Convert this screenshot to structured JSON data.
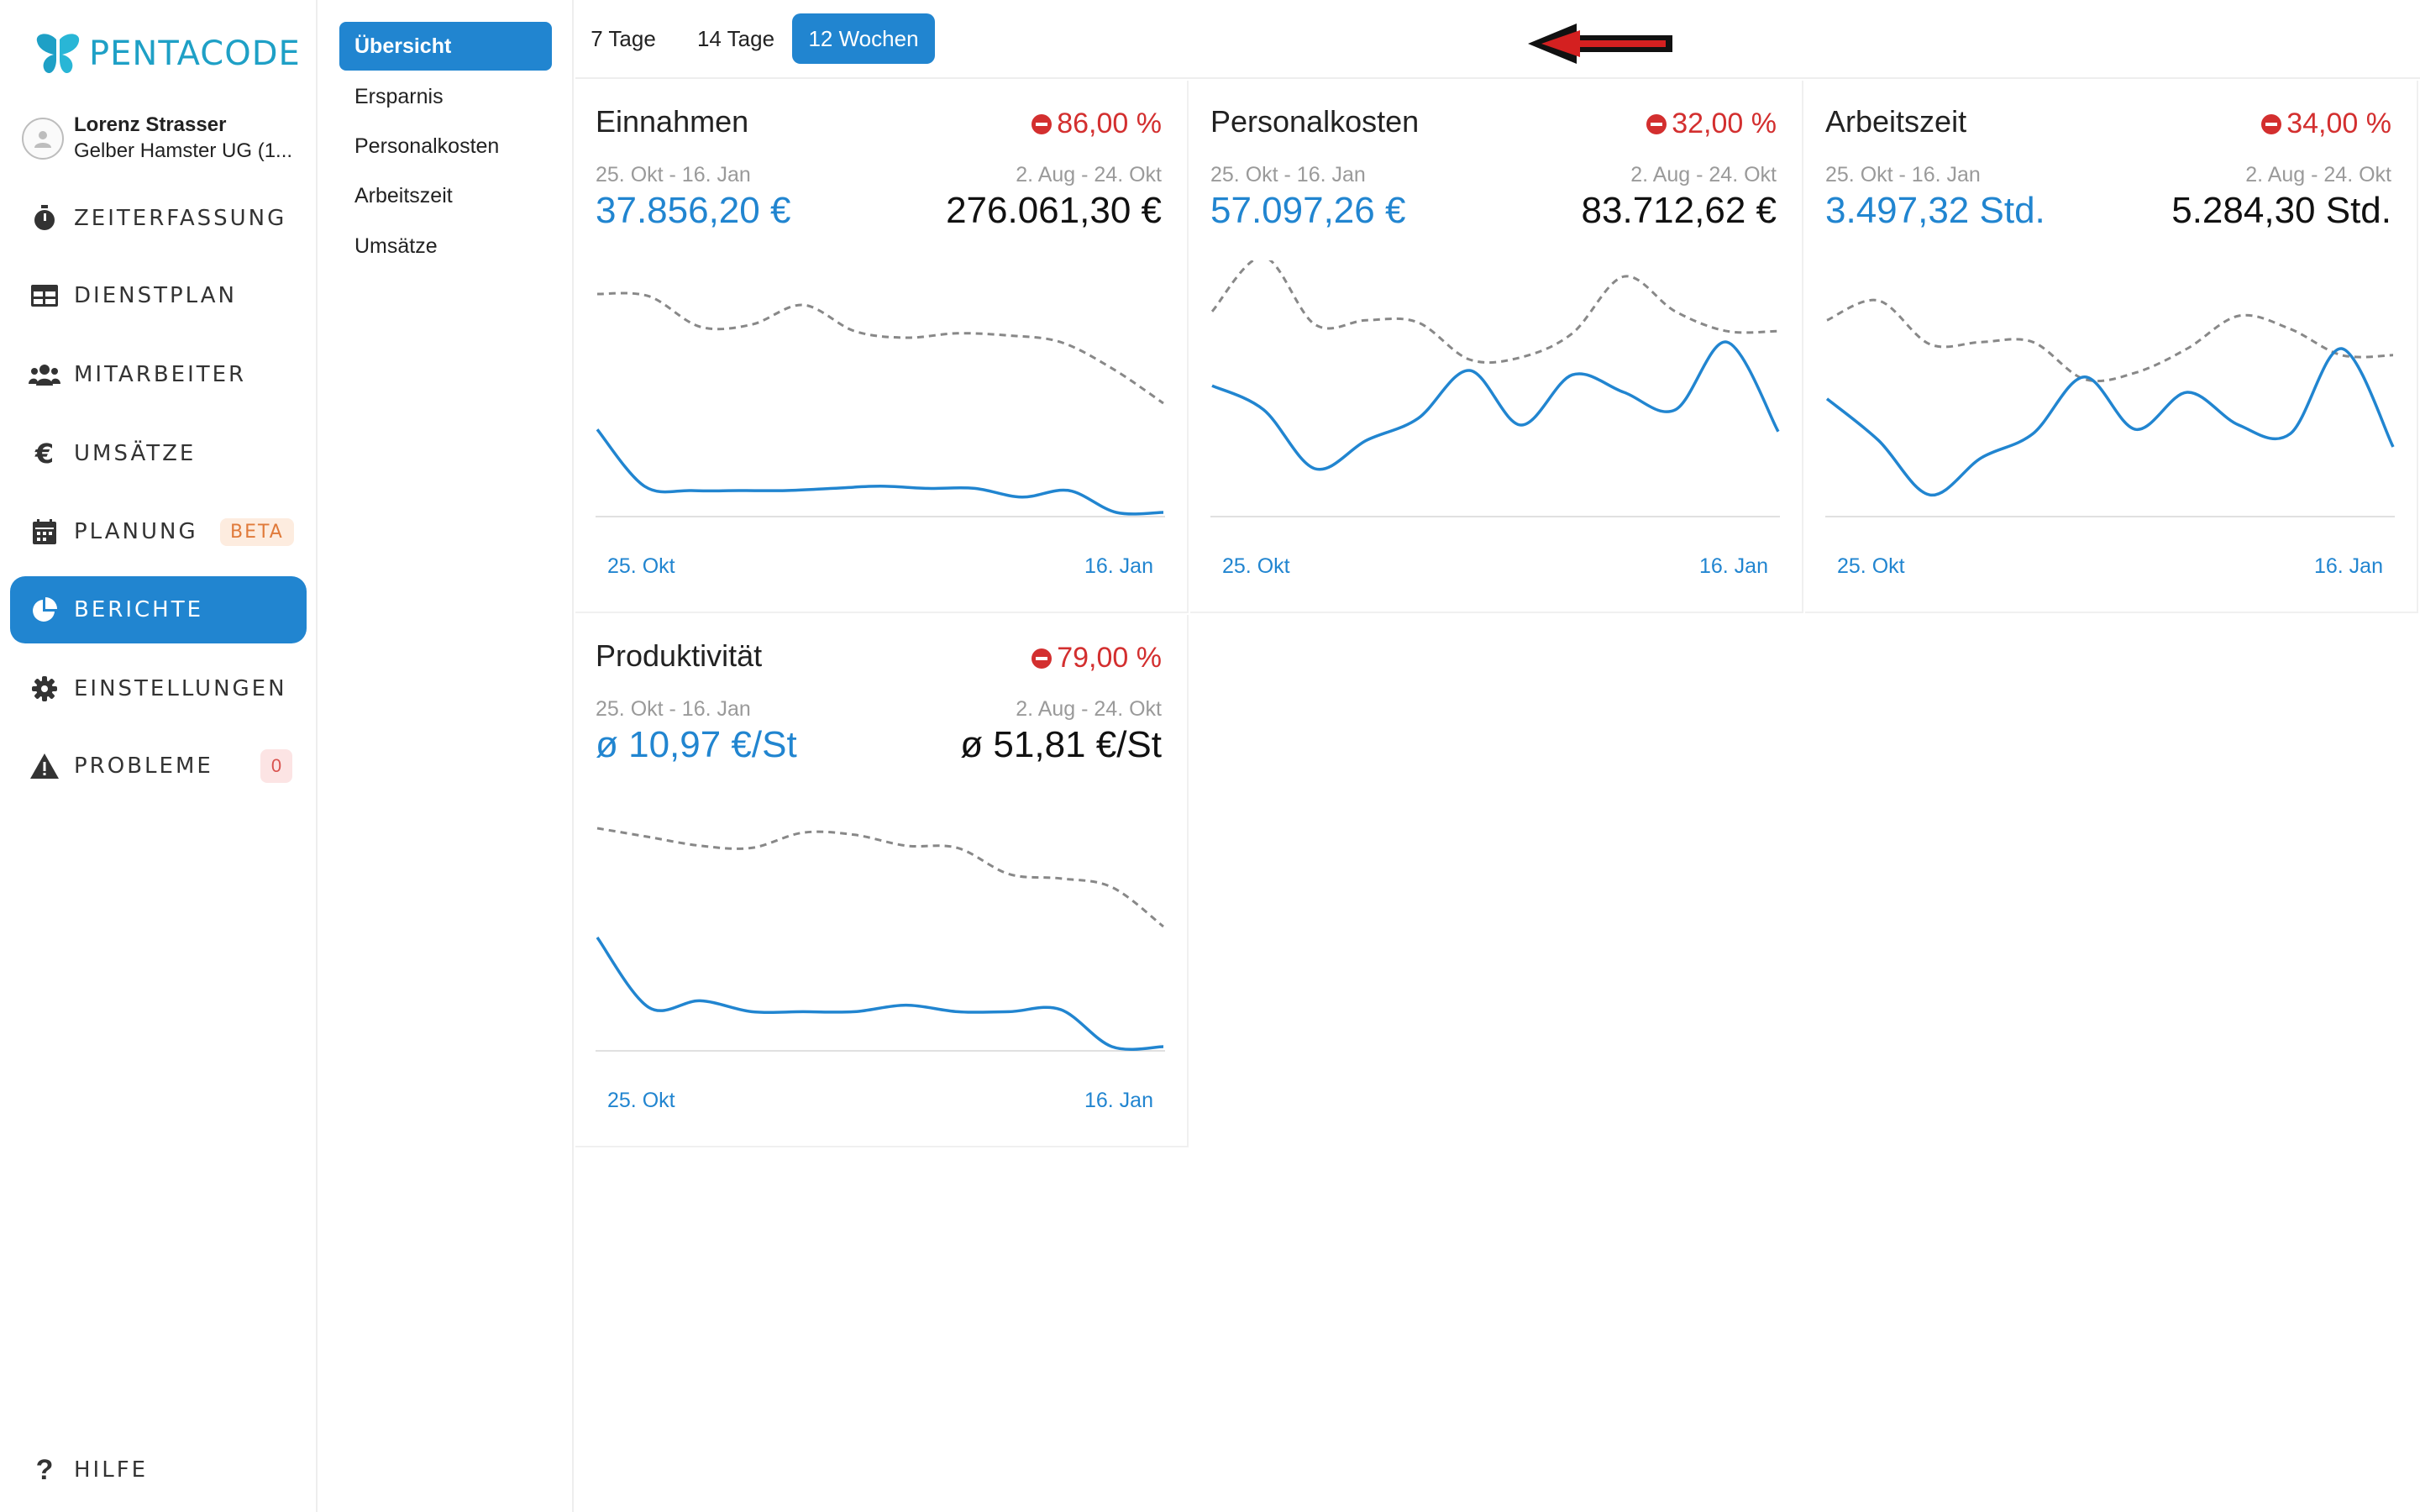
{
  "brand": {
    "name": "PENTACODE",
    "color": "#1ea0c6"
  },
  "user": {
    "name": "Lorenz Strasser",
    "company": "Gelber Hamster UG (1..."
  },
  "nav": {
    "items": [
      {
        "label": "ZEITERFASSUNG",
        "icon": "stopwatch-icon"
      },
      {
        "label": "DIENSTPLAN",
        "icon": "table-icon"
      },
      {
        "label": "MITARBEITER",
        "icon": "users-icon"
      },
      {
        "label": "UMSÄTZE",
        "icon": "euro-icon"
      },
      {
        "label": "PLANUNG",
        "icon": "calendar-icon",
        "badge": "BETA"
      },
      {
        "label": "BERICHTE",
        "icon": "pie-chart-icon",
        "active": true
      },
      {
        "label": "EINSTELLUNGEN",
        "icon": "gear-icon"
      },
      {
        "label": "PROBLEME",
        "icon": "warning-icon",
        "count": "0"
      }
    ],
    "help": "HILFE"
  },
  "subnav": {
    "items": [
      "Übersicht",
      "Ersparnis",
      "Personalkosten",
      "Arbeitszeit",
      "Umsätze"
    ],
    "active": "Übersicht"
  },
  "periods": {
    "options": [
      "7 Tage",
      "14 Tage",
      "12 Wochen"
    ],
    "active": "12 Wochen"
  },
  "colors": {
    "accent": "#2185d0",
    "negative": "#d32f2f",
    "muted": "#9a9a9a",
    "comparison_line": "#888888"
  },
  "cards": [
    {
      "title": "Einnahmen",
      "change": "86,00 %",
      "period_current": "25. Okt - 16. Jan",
      "period_previous": "2. Aug - 24. Okt",
      "value_current": "37.856,20 €",
      "value_previous": "276.061,30 €",
      "axis_start": "25. Okt",
      "axis_end": "16. Jan"
    },
    {
      "title": "Personalkosten",
      "change": "32,00 %",
      "period_current": "25. Okt - 16. Jan",
      "period_previous": "2. Aug - 24. Okt",
      "value_current": "57.097,26 €",
      "value_previous": "83.712,62 €",
      "axis_start": "25. Okt",
      "axis_end": "16. Jan"
    },
    {
      "title": "Arbeitszeit",
      "change": "34,00 %",
      "period_current": "25. Okt - 16. Jan",
      "period_previous": "2. Aug - 24. Okt",
      "value_current": "3.497,32 Std.",
      "value_previous": "5.284,30 Std.",
      "axis_start": "25. Okt",
      "axis_end": "16. Jan"
    },
    {
      "title": "Produktivität",
      "change": "79,00 %",
      "period_current": "25. Okt - 16. Jan",
      "period_previous": "2. Aug - 24. Okt",
      "value_current": "ø 10,97 €/St",
      "value_previous": "ø 51,81 €/St",
      "axis_start": "25. Okt",
      "axis_end": "16. Jan"
    }
  ],
  "chart_data": [
    {
      "type": "line",
      "series": [
        {
          "values": [
            0.38,
            0.12,
            0.1,
            0.1,
            0.1,
            0.11,
            0.12,
            0.11,
            0.11,
            0.07,
            0.1,
            0.0,
            0.0
          ]
        },
        {
          "values": [
            1.0,
            0.99,
            0.85,
            0.86,
            0.95,
            0.83,
            0.8,
            0.82,
            0.81,
            0.78,
            0.66,
            0.5
          ]
        }
      ]
    },
    {
      "type": "line",
      "series": [
        {
          "values": [
            0.58,
            0.47,
            0.2,
            0.33,
            0.43,
            0.65,
            0.4,
            0.63,
            0.55,
            0.47,
            0.78,
            0.37
          ]
        },
        {
          "values": [
            0.92,
            1.17,
            0.86,
            0.88,
            0.87,
            0.7,
            0.71,
            0.82,
            1.08,
            0.92,
            0.83,
            0.83
          ]
        }
      ]
    },
    {
      "type": "line",
      "series": [
        {
          "values": [
            0.52,
            0.33,
            0.08,
            0.25,
            0.36,
            0.62,
            0.38,
            0.55,
            0.4,
            0.36,
            0.75,
            0.3
          ]
        },
        {
          "values": [
            0.88,
            0.97,
            0.77,
            0.78,
            0.78,
            0.61,
            0.64,
            0.75,
            0.9,
            0.84,
            0.72,
            0.72
          ]
        }
      ]
    },
    {
      "type": "line",
      "series": [
        {
          "values": [
            0.5,
            0.18,
            0.21,
            0.16,
            0.16,
            0.16,
            0.19,
            0.16,
            0.16,
            0.17,
            0.0,
            0.0
          ]
        },
        {
          "values": [
            1.0,
            0.96,
            0.92,
            0.91,
            0.98,
            0.97,
            0.92,
            0.91,
            0.79,
            0.77,
            0.73,
            0.55
          ]
        }
      ]
    }
  ]
}
